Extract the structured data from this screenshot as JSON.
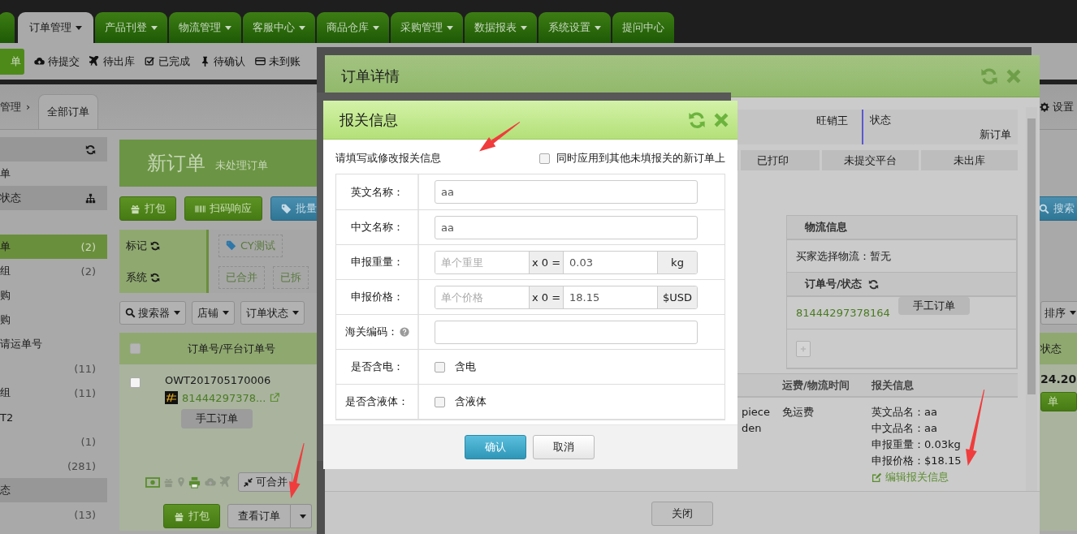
{
  "top_nav": {
    "tabs": [
      {
        "label": "订单管理",
        "dropdown": true,
        "selected": true
      },
      {
        "label": "产品刊登",
        "dropdown": true,
        "selected": false
      },
      {
        "label": "物流管理",
        "dropdown": true,
        "selected": false
      },
      {
        "label": "客服中心",
        "dropdown": true,
        "selected": false
      },
      {
        "label": "商品仓库",
        "dropdown": true,
        "selected": false
      },
      {
        "label": "采购管理",
        "dropdown": true,
        "selected": false
      },
      {
        "label": "数据报表",
        "dropdown": true,
        "selected": false
      },
      {
        "label": "系统设置",
        "dropdown": true,
        "selected": false
      },
      {
        "label": "提问中心",
        "dropdown": false,
        "selected": false
      }
    ]
  },
  "sub_nav": {
    "items": [
      {
        "label": "单",
        "kind": "button"
      },
      {
        "label": "待提交",
        "kind": "link"
      },
      {
        "label": "待出库",
        "kind": "link"
      },
      {
        "label": "已完成",
        "kind": "link"
      },
      {
        "label": "待确认",
        "kind": "link"
      },
      {
        "label": "未到账",
        "kind": "link"
      }
    ]
  },
  "breadcrumb": {
    "parent": "管理",
    "separator": "›",
    "tab": "全部订单",
    "settings": "设置"
  },
  "sidebar": {
    "items": [
      {
        "kind": "header"
      },
      {
        "kind": "item",
        "label": "单",
        "selected": false
      },
      {
        "kind": "header",
        "label": "状态"
      },
      {
        "kind": "blank"
      },
      {
        "kind": "item",
        "label": "单",
        "count": "(2)",
        "selected": true
      },
      {
        "kind": "item",
        "label": "组",
        "count": "(2)",
        "selected": false
      },
      {
        "kind": "item",
        "label": "购",
        "selected": false
      },
      {
        "kind": "item",
        "label": "购",
        "selected": false
      },
      {
        "kind": "item",
        "label": "请运单号",
        "selected": false
      },
      {
        "kind": "item",
        "count": "(11)",
        "selected": false
      },
      {
        "kind": "item",
        "label": "组",
        "count": "(11)",
        "selected": false
      },
      {
        "kind": "item",
        "label": "T2",
        "selected": false
      },
      {
        "kind": "item",
        "count": "(1)",
        "selected": false
      },
      {
        "kind": "item",
        "count": "(281)",
        "selected": false
      },
      {
        "kind": "header",
        "label": "态"
      },
      {
        "kind": "item",
        "count": "(13)",
        "selected": false
      }
    ]
  },
  "banner": {
    "title": "新订单",
    "subtitle": "未处理订单"
  },
  "toolbar": {
    "buttons": [
      {
        "label": "打包",
        "kind": "green"
      },
      {
        "label": "扫码响应",
        "kind": "green"
      },
      {
        "label": "批量",
        "kind": "blue"
      }
    ],
    "search": "搜索"
  },
  "tag_rows": [
    {
      "label": "标记",
      "tags": [
        {
          "label": "CY测试",
          "kind": "tag"
        }
      ]
    },
    {
      "label": "系统",
      "tags": [
        {
          "label": "已合并",
          "kind": "plain"
        },
        {
          "label": "已拆",
          "kind": "plain"
        }
      ]
    }
  ],
  "filters": {
    "buttons": [
      "搜索器",
      "店铺",
      "订单状态"
    ],
    "sort": "排序"
  },
  "order_table": {
    "select_all_checked": false,
    "columns": [
      "订单号/平台订单号"
    ],
    "status_column": "状态",
    "rows": [
      {
        "checked": false,
        "order_no": "OWT201705170006",
        "platform_no": "81444297378...",
        "tag": "手工订单",
        "merge": "可合并",
        "amount": "24.20",
        "status_button": "单",
        "actions": [
          "打包",
          "查看订单"
        ]
      }
    ]
  },
  "order_detail": {
    "title": "订单详情",
    "shop": "旺销王",
    "status_label": "状态",
    "status": "新订单",
    "steps": [
      "已打印",
      "未提交平台",
      "未出库"
    ],
    "logistics": {
      "header": "物流信息",
      "buyer_choice": "买家选择物流：暂无",
      "number_header": "订单号/状态",
      "tracking_no": "81444297378164",
      "tracking_tag": "手工订单"
    },
    "items": {
      "columns": [
        "运费/物流时间",
        "报关信息"
      ],
      "spec": [
        "piece",
        "den"
      ],
      "shipping": "免运费",
      "customs": [
        "英文品名：aa",
        "中文品名：aa",
        "申报重量：0.03kg",
        "申报价格：$18.15"
      ],
      "edit_link": "编辑报关信息"
    },
    "close": "关闭"
  },
  "customs_dialog": {
    "title": "报关信息",
    "hint": "请填写或修改报关信息",
    "apply_all": {
      "label": "同时应用到其他未填报关的新订单上",
      "checked": false
    },
    "fields": [
      {
        "kind": "text",
        "label": "英文名称：",
        "value": "aa",
        "help": false
      },
      {
        "kind": "text",
        "label": "中文名称：",
        "value": "aa",
        "help": false
      },
      {
        "kind": "calc",
        "label": "申报重量：",
        "placeholder": "单个重里",
        "multiplier": "x 0 =",
        "value": "0.03",
        "unit": "kg"
      },
      {
        "kind": "calc",
        "label": "申报价格：",
        "placeholder": "单个价格",
        "multiplier": "x 0 =",
        "value": "18.15",
        "unit": "$USD"
      },
      {
        "kind": "text",
        "label": "海关编码：",
        "help": true
      },
      {
        "kind": "check",
        "label": "是否含电：",
        "option": "含电",
        "checked": false
      },
      {
        "kind": "check",
        "label": "是否含液体：",
        "option": "含液体",
        "checked": false
      }
    ],
    "buttons": [
      {
        "label": "确认",
        "kind": "primary"
      },
      {
        "label": "取消",
        "kind": "default"
      }
    ]
  }
}
